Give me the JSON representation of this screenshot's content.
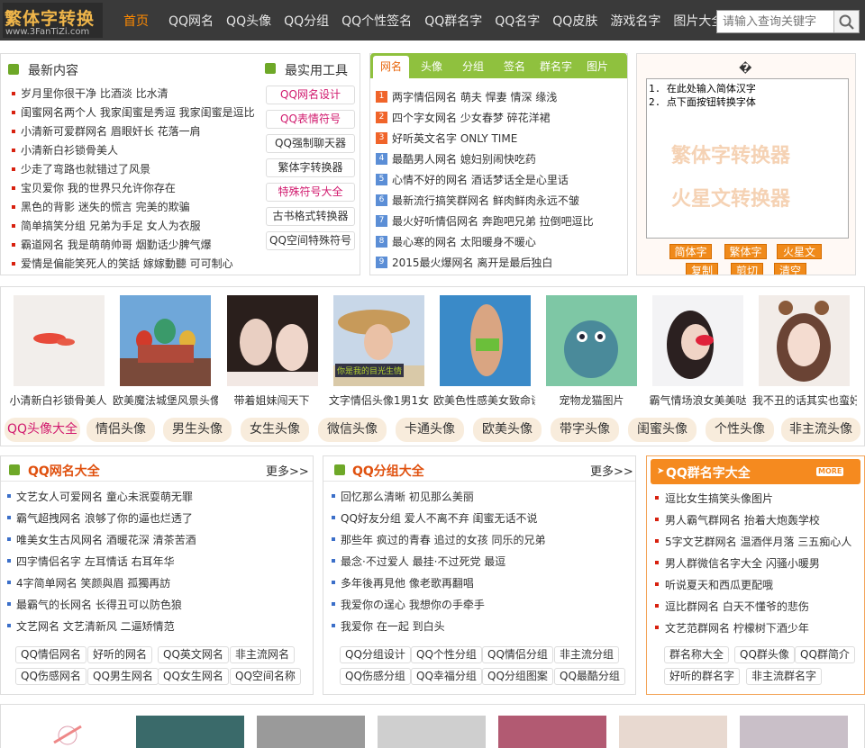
{
  "header": {
    "logo_text": "繁体字转换",
    "logo_url": "www.3FanTiZi.com",
    "nav": [
      "首页",
      "QQ网名",
      "QQ头像",
      "QQ分组",
      "QQ个性签名",
      "QQ群名字",
      "QQ名字",
      "QQ皮肤",
      "游戏名字",
      "图片大全"
    ],
    "search_placeholder": "请输入查询关键字"
  },
  "latest": {
    "title": "最新内容",
    "items": [
      "岁月里你很干净 比酒淡 比水清",
      "闺蜜网名两个人 我家闺蜜是秀逗 我家闺蜜是逗比",
      "小清新可爱群网名 眉眼奸长 花落一肩",
      "小清新白衫锁骨美人",
      "少走了弯路也就错过了风景",
      "宝贝爱你 我的世界只允许你存在",
      "黑色的背影 迷失的慌言 完美的欺骗",
      "简单搞笑分组 兄弟为手足 女人为衣服",
      "霸道网名 我是萌萌帅哥 烟勤话少脾气爆",
      "爱情是偏能笑死人的笑話 嫁嫁動聽 可可制心"
    ]
  },
  "tools": {
    "title": "最实用工具",
    "items": [
      "QQ网名设计",
      "QQ表情符号",
      "QQ强制聊天器",
      "繁体字转换器",
      "特殊符号大全",
      "古书格式转换器",
      "QQ空间特殊符号"
    ]
  },
  "tabs": {
    "labels": [
      "网名",
      "头像",
      "分组",
      "签名",
      "群名字",
      "图片"
    ],
    "items": [
      "两字情侣网名 萌夫 悍妻 情深 缘浅",
      "四个字女网名 少女春梦 碎花洋裙",
      "好听英文名字 ONLY TIME",
      "最酷男人网名 媳妇别闹快吃药",
      "心情不好的网名 酒话梦话全是心里话",
      "最新流行搞笑群网名 鲜肉鲜肉永远不皱",
      "最火好听情侣网名 奔跑吧兄弟 拉倒吧逗比",
      "最心寒的网名 太阳暖身不暖心",
      "2015最火爆网名 离开是最后独白"
    ]
  },
  "converter": {
    "top_glyph": "�",
    "textarea": "1. 在此处输入简体汉字\n2. 点下面按钮转换字体",
    "watermark1": "繁体字转换器",
    "watermark2": "火星文转换器",
    "buttons": [
      "简体字",
      "繁体字",
      "火星文",
      "复制",
      "剪切",
      "清空"
    ]
  },
  "gallery": {
    "captions": [
      "小清新白衫锁骨美人",
      "欧美魔法城堡风景头像",
      "带着姐妹闯天下",
      "文字情侣头像1男1女",
      "欧美色性感美女致命诱惑",
      "宠物龙猫图片",
      "霸气情场浪女美美哒",
      "我不丑的话其实也蛮好看"
    ],
    "overlay_text": "你是我的目光生情",
    "chips": [
      "QQ头像大全",
      "情侣头像",
      "男生头像",
      "女生头像",
      "微信头像",
      "卡通头像",
      "欧美头像",
      "带字头像",
      "闺蜜头像",
      "个性头像",
      "非主流头像"
    ]
  },
  "names": {
    "title": "QQ网名大全",
    "more": "更多>>",
    "items": [
      "文艺女人可爱网名 童心未泯耍萌无罪",
      "霸气超拽网名 浪够了你的逼也烂透了",
      "唯美女生古风网名 酒暖花深 清茶苦酒",
      "四字情侣名字 左耳情话 右耳年华",
      "4字简单网名 笑颜與眉 孤獨再訪",
      "最霸气的长网名 长得丑可以防色狼",
      "文艺网名 文艺清新风 二逼矫情范"
    ],
    "tags": [
      "QQ情侣网名",
      "好听的网名",
      "QQ英文网名",
      "非主流网名",
      "QQ伤感网名",
      "QQ男生网名",
      "QQ女生网名",
      "QQ空间名称"
    ]
  },
  "groups": {
    "title": "QQ分组大全",
    "more": "更多>>",
    "items": [
      "回忆那么清晰 初见那么美丽",
      "QQ好友分组 爱人不离不弃 闺蜜无话不说",
      "那些年 疯过的青春 追过的女孩 同乐的兄弟",
      "最念·不过爱人 最挂·不过死党 最逗",
      "多年後再見他 像老歌再翻唱",
      "我爱你の逞心 我想你の手牵手",
      "我爱你 在一起 到白头"
    ],
    "tags": [
      "QQ分组设计",
      "QQ个性分组",
      "QQ情侣分组",
      "非主流分组",
      "QQ伤感分组",
      "QQ幸福分组",
      "QQ分组图案",
      "QQ最酷分组"
    ]
  },
  "groupnames": {
    "title": "QQ群名字大全",
    "more": "MORE",
    "items": [
      "逗比女生搞笑头像图片",
      "男人霸气群网名 抬着大炮轰学校",
      "5字文艺群网名 温酒伴月落 三五痴心人",
      "男人群微信名字大全 闪骚小暖男",
      "听说夏天和西瓜更配哦",
      "逗比群网名 白天不懂爷的悲伤",
      "文艺范群网名 柠檬树下酒少年"
    ],
    "tags": [
      "群名称大全",
      "QQ群头像",
      "QQ群简介",
      "好听的群名字",
      "非主流群名字"
    ]
  }
}
